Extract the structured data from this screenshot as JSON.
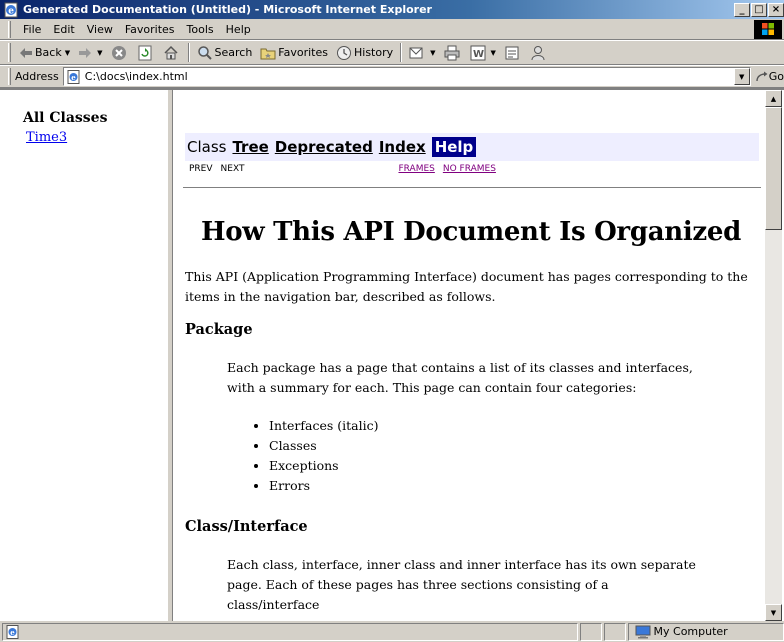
{
  "window": {
    "title": "Generated Documentation (Untitled) - Microsoft Internet Explorer",
    "minimize_glyph": "_",
    "maximize_glyph": "□",
    "close_glyph": "×"
  },
  "menu": [
    "File",
    "Edit",
    "View",
    "Favorites",
    "Tools",
    "Help"
  ],
  "toolbar": {
    "back": "Back",
    "search": "Search",
    "favorites": "Favorites",
    "history": "History"
  },
  "address": {
    "label": "Address",
    "value": "C:\\docs\\index.html",
    "go": "Go"
  },
  "left_frame": {
    "heading": "All Classes",
    "classes": [
      "Time3"
    ]
  },
  "nav": {
    "items": [
      {
        "label": "Class",
        "state": "plain"
      },
      {
        "label": "Tree",
        "state": "link"
      },
      {
        "label": "Deprecated",
        "state": "link"
      },
      {
        "label": "Index",
        "state": "link"
      },
      {
        "label": "Help",
        "state": "current"
      }
    ],
    "prev": "PREV",
    "next": "NEXT",
    "frames": "FRAMES",
    "no_frames": "NO FRAMES"
  },
  "doc": {
    "title": "How This API Document Is Organized",
    "intro": "This API (Application Programming Interface) document has pages corresponding to the items in the navigation bar, described as follows.",
    "package_heading": "Package",
    "package_text": "Each package has a page that contains a list of its classes and interfaces, with a summary for each. This page can contain four categories:",
    "package_items": [
      "Interfaces (italic)",
      "Classes",
      "Exceptions",
      "Errors"
    ],
    "class_heading": "Class/Interface",
    "class_text": "Each class, interface, inner class and inner interface has its own separate page. Each of these pages has three sections consisting of a class/interface"
  },
  "status": {
    "zone": "My Computer"
  },
  "colors": {
    "titlebar_start": "#0a246a",
    "nav_background": "#eeeeff",
    "nav_current": "#00008b",
    "link": "#0000ee",
    "visited_link": "#800080"
  }
}
